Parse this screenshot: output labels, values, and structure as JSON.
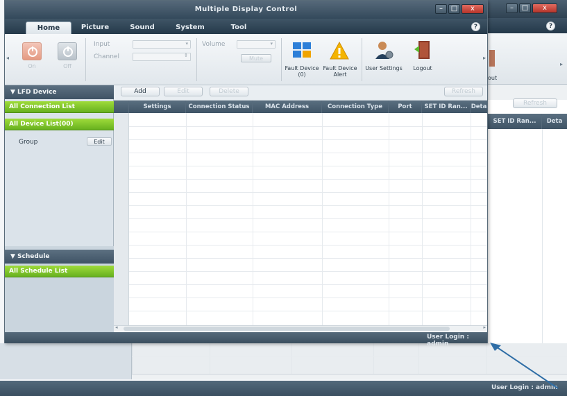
{
  "window": {
    "title": "Multiple Display Control",
    "min": "–",
    "max": "□",
    "close": "x",
    "help": "?"
  },
  "background_window": {
    "min": "–",
    "max": "□",
    "close": "x",
    "help": "?",
    "ribbon_cut_label": "out",
    "toolbar_button": "Refresh",
    "columns": [
      "SET ID Ran...",
      "Deta"
    ],
    "status": "User Login : admin"
  },
  "tabs": [
    "Home",
    "Picture",
    "Sound",
    "System",
    "Tool"
  ],
  "ribbon": {
    "power_on_label": "On",
    "power_off_label": "Off",
    "input_label": "Input",
    "channel_label": "Channel",
    "volume_label": "Volume",
    "mute_label": "Mute",
    "fault_device_label": "Fault Device",
    "fault_device_sub": "(0)",
    "fault_alert_label": "Fault Device",
    "fault_alert_sub": "Alert",
    "user_settings_label": "User Settings",
    "logout_label": "Logout"
  },
  "left_panel": {
    "lfd_header": "▼ LFD Device",
    "all_connection": "All Connection List",
    "all_device": "All Device List(00)",
    "group_label": "Group",
    "group_edit": "Edit",
    "schedule_header": "▼ Schedule",
    "all_schedule": "All Schedule List"
  },
  "toolbar": {
    "add": "Add",
    "edit": "Edit",
    "delete": "Delete",
    "refresh": "Refresh"
  },
  "grid": {
    "columns": [
      "Settings",
      "Connection Status",
      "MAC Address",
      "Connection Type",
      "Port",
      "SET ID Ran...",
      "Deta"
    ]
  },
  "status_bar": {
    "login": "User Login : admin"
  }
}
